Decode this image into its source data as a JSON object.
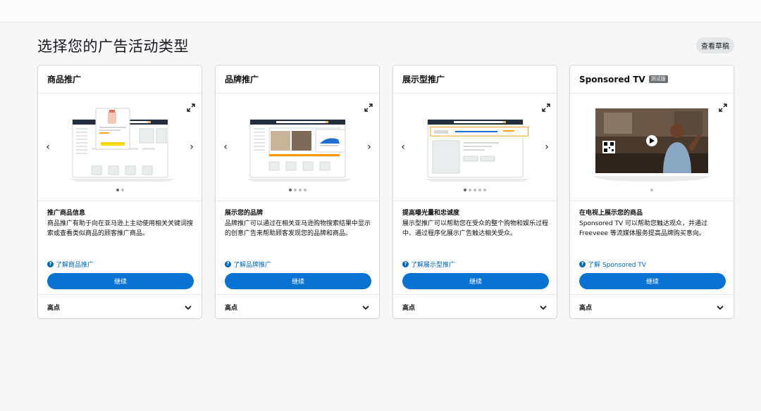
{
  "header": {
    "title": "选择您的广告活动类型",
    "drafts_label": "查看草稿"
  },
  "cards": [
    {
      "title": "商品推广",
      "badge": "",
      "desc_title": "推广商品信息",
      "desc_text": "商品推广有助于向在亚马逊上主动使用相关关键词搜索或查看类似商品的顾客推广商品。",
      "learn_more": "了解商品推广",
      "continue_label": "继续",
      "highlights_label": "高点",
      "dots": 2,
      "active_dot": 0
    },
    {
      "title": "品牌推广",
      "badge": "",
      "desc_title": "展示您的品牌",
      "desc_text": "品牌推广可以通过在相关亚马逊购物搜索结果中显示的创意广告来帮助顾客发现您的品牌和商品。",
      "learn_more": "了解品牌推广",
      "continue_label": "继续",
      "highlights_label": "高点",
      "dots": 4,
      "active_dot": 0
    },
    {
      "title": "展示型推广",
      "badge": "",
      "desc_title": "提高曝光量和忠诚度",
      "desc_text": "展示型推广可以帮助您在受众的整个购物和娱乐过程中、通过程序化展示广告触达相关受众。",
      "learn_more": "了解展示型推广",
      "continue_label": "继续",
      "highlights_label": "高点",
      "dots": 5,
      "active_dot": 0
    },
    {
      "title": "Sponsored TV",
      "badge": "测试版",
      "desc_title": "在电视上展示您的商品",
      "desc_text": "Sponsored TV 可以帮助您触达观众，并通过 Freeveee 等流媒体服务提高品牌购买意向。",
      "learn_more": "了解 Sponsored TV",
      "continue_label": "继续",
      "highlights_label": "高点",
      "dots": 1,
      "active_dot": 0
    }
  ],
  "icons": {
    "expand": "expand-icon",
    "prev": "chevron-left-icon",
    "next": "chevron-right-icon",
    "help": "help-icon",
    "collapse": "chevron-down-icon"
  },
  "colors": {
    "primary": "#0972d3",
    "link": "#0066c0",
    "amazon_orange": "#ff9900"
  }
}
